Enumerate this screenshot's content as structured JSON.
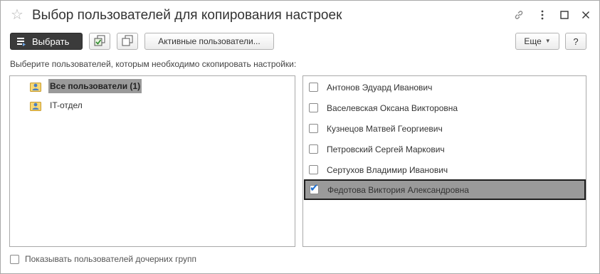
{
  "window": {
    "title": "Выбор пользователей для копирования настроек"
  },
  "titlebar_icons": [
    "star-icon",
    "link-icon",
    "more-vertical-icon",
    "maximize-icon",
    "close-icon"
  ],
  "toolbar": {
    "select_label": "Выбрать",
    "active_users_label": "Активные пользователи...",
    "more_label": "Еще",
    "help_label": "?"
  },
  "prompt": "Выберите пользователей, которым необходимо скопировать настройки:",
  "groups": [
    {
      "label": "Все пользователи (1)",
      "selected": true
    },
    {
      "label": "IT-отдел",
      "selected": false
    }
  ],
  "users": [
    {
      "name": "Антонов Эдуард Иванович",
      "checked": false
    },
    {
      "name": "Васелевская Оксана Викторовна",
      "checked": false
    },
    {
      "name": "Кузнецов Матвей Георгиевич",
      "checked": false
    },
    {
      "name": "Петровский Сергей Маркович",
      "checked": false
    },
    {
      "name": "Сертухов Владимир Иванович",
      "checked": false
    },
    {
      "name": "Федотова Виктория Александровна",
      "checked": true,
      "selected": true
    }
  ],
  "show_child_groups": {
    "label": "Показывать пользователей дочерних групп",
    "checked": false
  },
  "colors": {
    "primary_button": "#3b3b3b",
    "selection": "#9a9a9a",
    "check": "#1f6fd0"
  }
}
